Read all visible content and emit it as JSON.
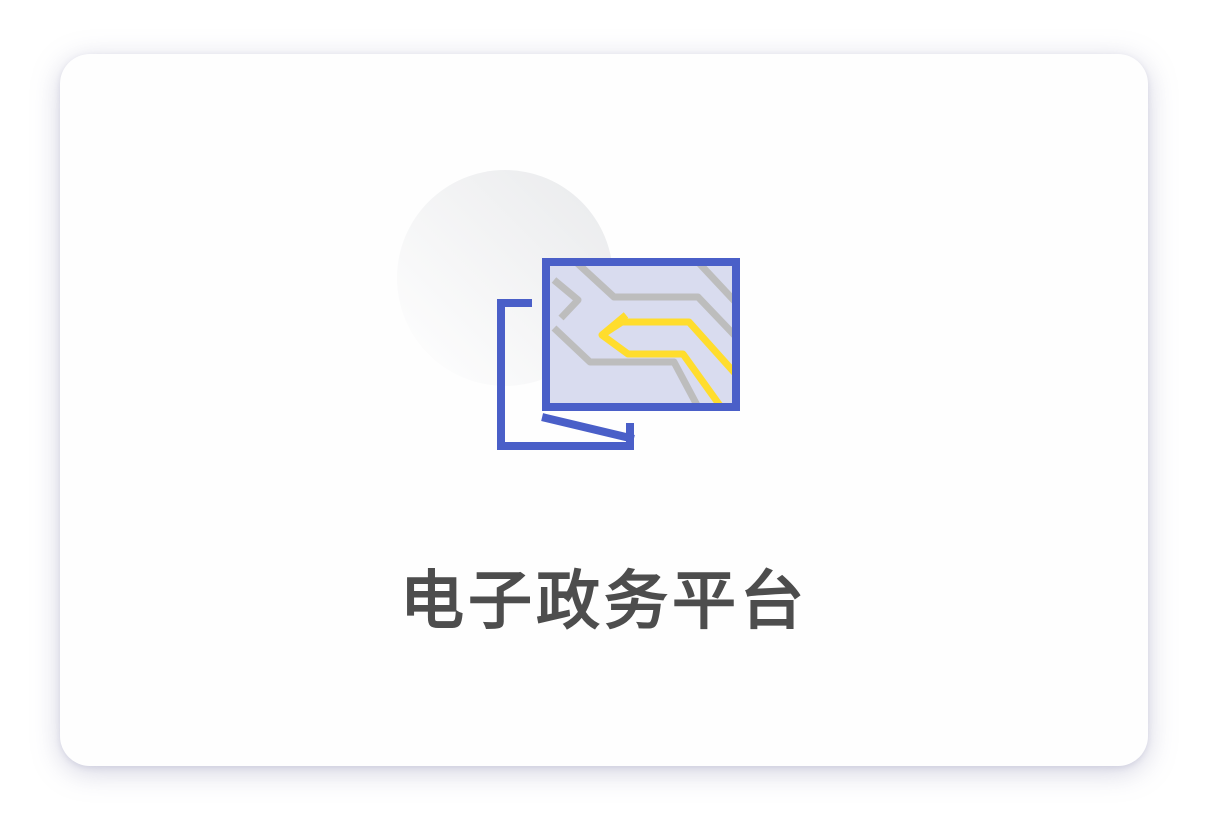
{
  "card": {
    "title": "电子政务平台",
    "icon": "map-document-icon"
  },
  "colors": {
    "card_background": "#fefefe",
    "title_text": "#4d4d4d",
    "icon_frame": "#4a5fc8",
    "icon_fill": "#d9dcef",
    "icon_route": "#ffdd2d",
    "icon_roads": "#bdbdbd"
  }
}
